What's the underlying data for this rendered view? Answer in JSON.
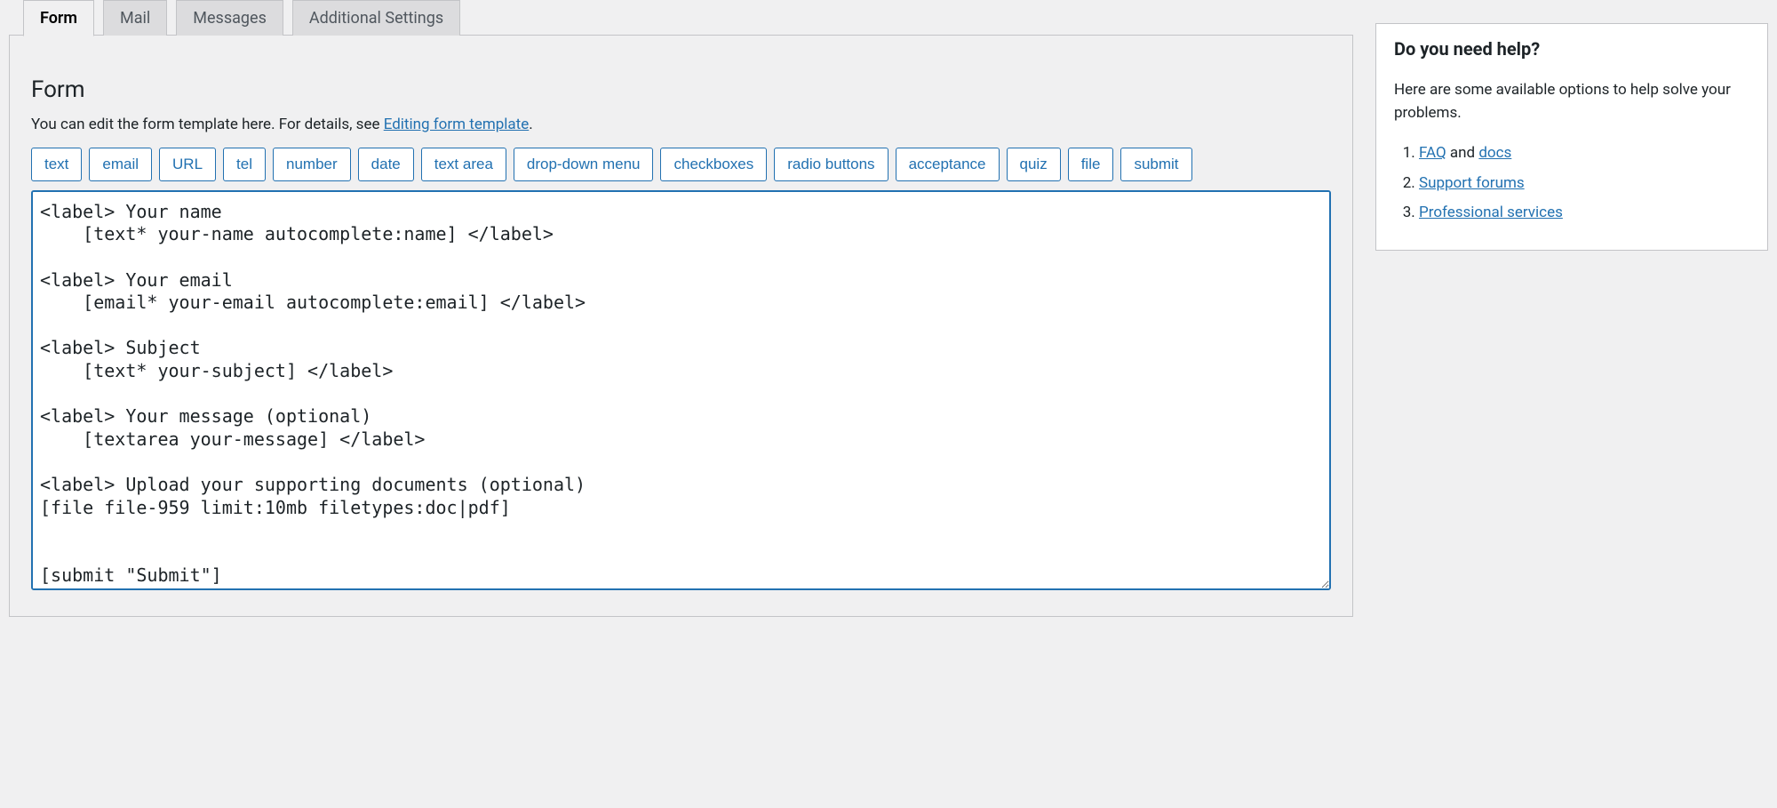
{
  "tabs": [
    {
      "label": "Form",
      "active": true
    },
    {
      "label": "Mail",
      "active": false
    },
    {
      "label": "Messages",
      "active": false
    },
    {
      "label": "Additional Settings",
      "active": false
    }
  ],
  "form_panel": {
    "title": "Form",
    "desc_prefix": "You can edit the form template here. For details, see ",
    "desc_link": "Editing form template",
    "desc_suffix": ".",
    "tag_buttons": [
      "text",
      "email",
      "URL",
      "tel",
      "number",
      "date",
      "text area",
      "drop-down menu",
      "checkboxes",
      "radio buttons",
      "acceptance",
      "quiz",
      "file",
      "submit"
    ],
    "textarea_value": "<label> Your name\n    [text* your-name autocomplete:name] </label>\n\n<label> Your email\n    [email* your-email autocomplete:email] </label>\n\n<label> Subject\n    [text* your-subject] </label>\n\n<label> Your message (optional)\n    [textarea your-message] </label>\n\n<label> Upload your supporting documents (optional)\n[file file-959 limit:10mb filetypes:doc|pdf]\n\n\n[submit \"Submit\"]"
  },
  "help_box": {
    "title": "Do you need help?",
    "desc": "Here are some available options to help solve your problems.",
    "items": [
      {
        "link": "FAQ",
        "after": " and ",
        "link2": "docs"
      },
      {
        "link": "Support forums"
      },
      {
        "link": "Professional services"
      }
    ]
  }
}
